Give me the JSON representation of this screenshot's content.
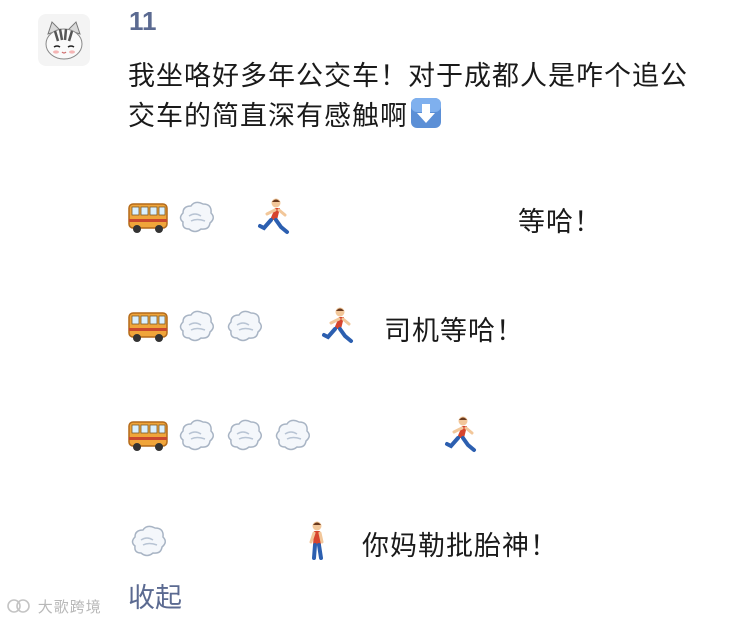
{
  "comment": {
    "username": "11",
    "line1": "我坐咯好多年公交车！对于成都人是咋个追公",
    "line2": "交车的简直深有感触啊",
    "arrow_icon": "down-arrow-icon"
  },
  "rows": [
    {
      "icons": [
        "bus-icon",
        "dash-cloud-icon",
        "runner-icon"
      ],
      "text": "等哈！"
    },
    {
      "icons": [
        "bus-icon",
        "dash-cloud-icon",
        "dash-cloud-icon",
        "runner-icon"
      ],
      "text": "司机等哈！"
    },
    {
      "icons": [
        "bus-icon",
        "dash-cloud-icon",
        "dash-cloud-icon",
        "dash-cloud-icon",
        "runner-icon"
      ],
      "text": ""
    },
    {
      "icons": [
        "dash-cloud-icon",
        "walker-icon"
      ],
      "text": "你妈勒批胎神！"
    }
  ],
  "collapse_label": "收起",
  "watermark": "大歌跨境",
  "colors": {
    "link": "#5b6a91",
    "text": "#1a1a1a",
    "bus": "#f0a53a",
    "arrow_bg": "#5b8fd6"
  }
}
